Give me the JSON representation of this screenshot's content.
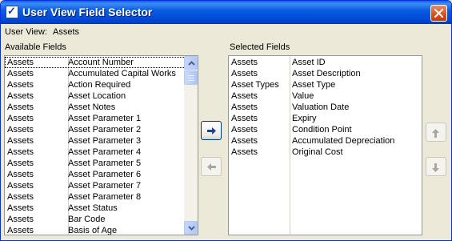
{
  "window": {
    "title": "User View Field Selector"
  },
  "user_view": {
    "label": "User View:",
    "value": "Assets"
  },
  "available": {
    "label": "Available Fields",
    "rows": [
      {
        "category": "Assets",
        "field": "Account Number"
      },
      {
        "category": "Assets",
        "field": "Accumulated Capital Works"
      },
      {
        "category": "Assets",
        "field": "Action Required"
      },
      {
        "category": "Assets",
        "field": "Asset Location"
      },
      {
        "category": "Assets",
        "field": "Asset Notes"
      },
      {
        "category": "Assets",
        "field": "Asset Parameter 1"
      },
      {
        "category": "Assets",
        "field": "Asset Parameter 2"
      },
      {
        "category": "Assets",
        "field": "Asset Parameter 3"
      },
      {
        "category": "Assets",
        "field": "Asset Parameter 4"
      },
      {
        "category": "Assets",
        "field": "Asset Parameter 5"
      },
      {
        "category": "Assets",
        "field": "Asset Parameter 6"
      },
      {
        "category": "Assets",
        "field": "Asset Parameter 7"
      },
      {
        "category": "Assets",
        "field": "Asset Parameter 8"
      },
      {
        "category": "Assets",
        "field": "Asset Status"
      },
      {
        "category": "Assets",
        "field": "Bar Code"
      },
      {
        "category": "Assets",
        "field": "Basis of Age"
      }
    ]
  },
  "selected": {
    "label": "Selected Fields",
    "rows": [
      {
        "category": "Assets",
        "field": "Asset ID"
      },
      {
        "category": "Assets",
        "field": "Asset Description"
      },
      {
        "category": "Asset Types",
        "field": "Asset Type"
      },
      {
        "category": "Assets",
        "field": "Value"
      },
      {
        "category": "Assets",
        "field": "Valuation Date"
      },
      {
        "category": "Assets",
        "field": "Expiry"
      },
      {
        "category": "Assets",
        "field": "Condition Point"
      },
      {
        "category": "Assets",
        "field": "Accumulated Depreciation"
      },
      {
        "category": "Assets",
        "field": "Original Cost"
      }
    ]
  },
  "icons": {
    "add": "arrow-right-icon",
    "remove": "arrow-left-icon",
    "move_up": "arrow-up-icon",
    "move_down": "arrow-down-icon",
    "close": "close-icon",
    "app": "checkmark-app-icon"
  },
  "colors": {
    "titlebar": "#0054e3",
    "close_button": "#d4501f",
    "arrow_active": "#1f3f8f"
  }
}
